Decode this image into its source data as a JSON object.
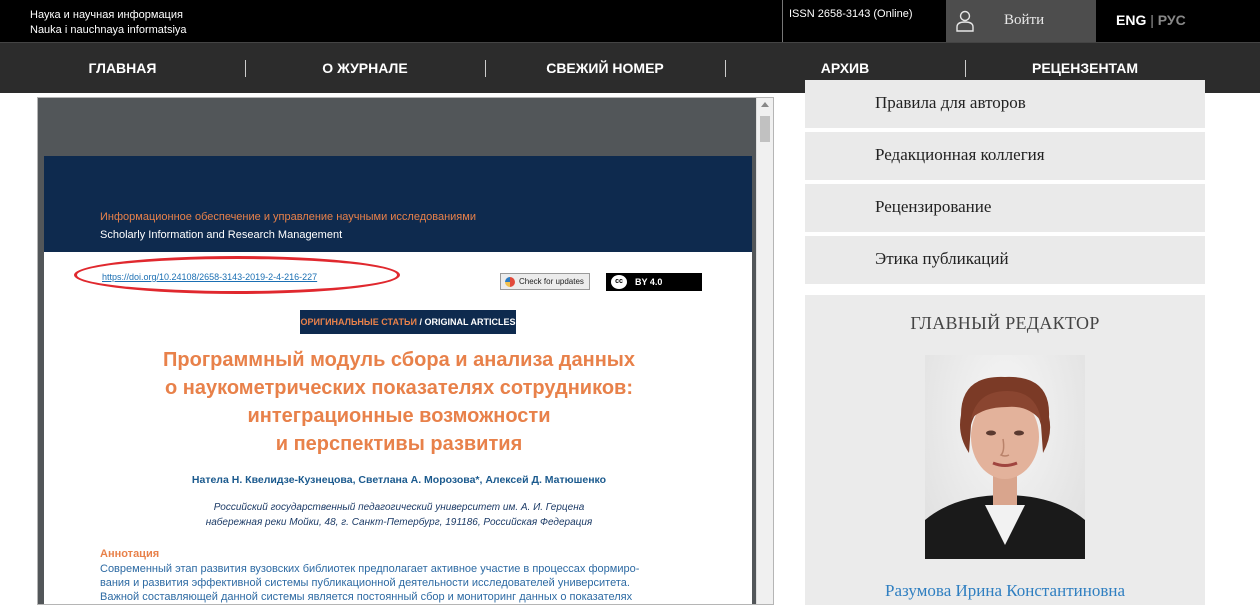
{
  "header": {
    "journal_ru": "Наука и научная информация",
    "journal_en": "Nauka i nauchnaya informatsiya",
    "issn": "ISSN 2658-3143 (Online)",
    "login_label": "Войти",
    "lang_active": "ENG",
    "lang_separator": "|",
    "lang_inactive": "РУС"
  },
  "nav": {
    "items": [
      {
        "label": "ГЛАВНАЯ"
      },
      {
        "label": "О ЖУРНАЛЕ"
      },
      {
        "label": "СВЕЖИЙ НОМЕР"
      },
      {
        "label": "АРХИВ"
      },
      {
        "label": "РЕЦЕНЗЕНТАМ"
      }
    ]
  },
  "pdf": {
    "journal_ru": "Информационное обеспечение и управление научными исследованиями",
    "journal_en": "Scholarly Information and Research Management",
    "doi": "https://doi.org/10.24108/2658-3143-2019-2-4-216-227",
    "check_updates": "Check for updates",
    "cc_symbol": "cc",
    "license": "BY  4.0",
    "rubric_ru": "ОРИГИНАЛЬНЫЕ СТАТЬИ",
    "rubric_sep": " / ",
    "rubric_en": "ORIGINAL ARTICLES",
    "title_lines": [
      "Программный модуль сбора и анализа данных",
      "о наукометрических показателях сотрудников:",
      "интеграционные возможности",
      "и перспективы развития"
    ],
    "authors": "Нателa Н. Квелидзе-Кузнецова, Светлана А. Морозова*, Алексей Д. Матюшенко",
    "affiliation_lines": [
      "Российский государственный педагогический университет им. А. И. Герцена",
      "набережная реки Мойки, 48, г. Санкт-Петербург, 191186, Российская Федерация"
    ],
    "abstract_heading": "Аннотация",
    "abstract_lines": [
      "Современный этап развития вузовских библиотек предполагает активное участие в процессах формиро-",
      "вания и развития эффективной системы публикационной деятельности исследователей университета.",
      "Важной составляющей данной системы является постоянный сбор и мониторинг данных о показателях"
    ]
  },
  "sidebar": {
    "links": [
      {
        "label": "Правила для авторов"
      },
      {
        "label": "Редакционная коллегия"
      },
      {
        "label": "Рецензирование"
      },
      {
        "label": "Этика публикаций"
      }
    ],
    "editor_heading": "ГЛАВНЫЙ РЕДАКТОР",
    "editor_name": "Разумова Ирина Константиновна"
  },
  "colors": {
    "topbar": "#000000",
    "navbar": "#2c2c2c",
    "pdf_header": "#0e2a4e",
    "accent_orange": "#e8814a",
    "doi_highlight": "#e0282e",
    "editor_name": "#2f7fc1"
  },
  "icons": {
    "login": "user-icon",
    "check_updates": "crossmark-icon",
    "license": "cc-icon"
  }
}
